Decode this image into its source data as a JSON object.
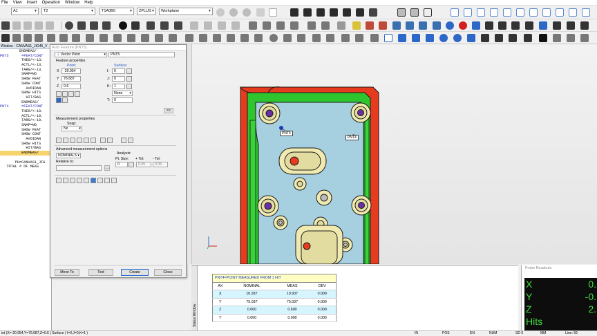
{
  "menu": {
    "items": [
      "File",
      "View",
      "Insert",
      "Operation",
      "Window",
      "Help"
    ]
  },
  "toolbar1": {
    "combo_alignment": "A1",
    "combo_probe": "T2",
    "combo_tip": "T1A0B0",
    "combo_plane": "ZPLUS",
    "combo_workplane": "Workplane"
  },
  "edit_window": {
    "title": "Window - CANVAS1_JIG45_V",
    "lines": [
      "         ENDMEAS/",
      "PNT3      =FEAT/CONT",
      "          THEO/<-13.",
      "          ACTL/<-13.",
      "          TARG/<-13.",
      "          SNAP=NO",
      "          SHOW FEAT",
      "          SHOW CONT",
      "            AVOIDAN",
      "          SHOW HITS",
      "            HIT/BAS",
      "          ENDMEAS/",
      "PNT4      =FEAT/CONT",
      "          THEO/<-10.",
      "          ACTL/<-10.",
      "          TARG/<-10.",
      "          SNAP=NO",
      "          SHOW FEAT",
      "          SHOW CONT",
      "            AVOIDAN",
      "          SHOW HITS",
      "            HIT/BAS",
      "          ENDMEAS/",
      "",
      "       PH=CANVAS1_JIG",
      "   TOTAL # OF MEAS"
    ]
  },
  "dialog": {
    "title": "Auto Feature [PNT5]",
    "feature_type": "Vector Point",
    "feature_id": "PNT5",
    "section_feature_props": "Feature properties",
    "point_label": "Point:",
    "surface_label": "Surface:",
    "x_label": "X",
    "y_label": "Y",
    "z_label": "Z",
    "i_label": "I:",
    "j_label": "J:",
    "k_label": "K:",
    "t_label": "T:",
    "x_value": "-20.954",
    "y_value": "76.687",
    "z_value": "0.6",
    "i_value": "0",
    "j_value": "0",
    "k_value": "1",
    "t_value": "0",
    "none_option": "None",
    "collapse_label": "<<",
    "section_measurement_props": "Measurement properties",
    "snap_label": "Snap:",
    "snap_value": "No",
    "section_advanced": "Advanced measurement options",
    "nominals_value": "NOMINALS",
    "relative_to_label": "Relative to:",
    "analysis_label": "Analysis:",
    "pt_size_label": "Pt. Size:",
    "plus_tol_label": "+ Tol:",
    "minus_tol_label": "- Tol:",
    "pt_size_value": "0",
    "plus_tol_value": "0.05",
    "minus_tol_value": "0.05",
    "btn_move_to": "Move To",
    "btn_test": "Test",
    "btn_create": "Create",
    "btn_close": "Close"
  },
  "graphics": {
    "labels": [
      "PNT5",
      "PNT4"
    ]
  },
  "status_window": {
    "tab_label": "Status Window",
    "caption": "PNT4=POINT MEASURED FROM 1 HIT",
    "headers": [
      "AX",
      "NOMINAL",
      "MEAS",
      "DEV"
    ],
    "rows": [
      [
        "X",
        "10.937",
        "10.937",
        "0.000"
      ],
      [
        "Y",
        "75.037",
        "75.037",
        "0.000"
      ],
      [
        "Z",
        "0.600",
        "0.600",
        "0.000"
      ],
      [
        "T",
        "0.000",
        "0.000",
        "0.000"
      ]
    ]
  },
  "probe_readouts": {
    "title": "Probe Readouts",
    "rows": [
      {
        "axis": "X",
        "value": "0."
      },
      {
        "axis": "Y",
        "value": "-0."
      },
      {
        "axis": "Z",
        "value": "2."
      },
      {
        "axis": "Hits",
        "value": ""
      }
    ]
  },
  "status_bar": {
    "coords": "int (X=-20.954,Y=76.687,Z=0.6 ) Surface ( I=0,J=0,K=1 )",
    "units": "IN",
    "pos": "POS",
    "lang": "EN",
    "num": "NUM",
    "sd": "SD 0",
    "mm": "MM",
    "line": "Line: 59"
  },
  "colors": {
    "part_blue": "#a6cfe0",
    "part_green": "#2ec52e",
    "part_red": "#e63b1e",
    "boss_yellow": "#f0eab0",
    "hole_purple": "#6a2fa6",
    "readout_green": "#3fe03f"
  }
}
